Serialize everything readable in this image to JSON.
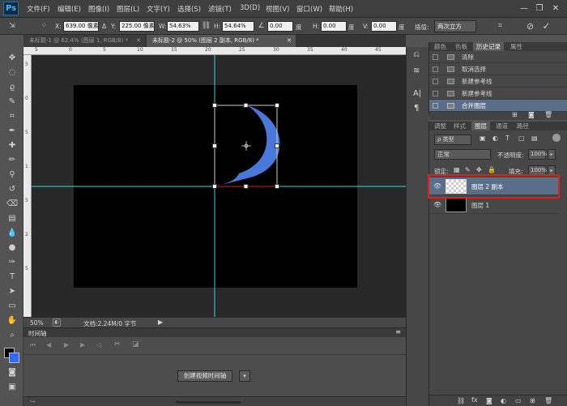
{
  "app": {
    "logo": "Ps"
  },
  "menu": [
    "文件(F)",
    "编辑(E)",
    "图像(I)",
    "图层(L)",
    "文字(Y)",
    "选择(S)",
    "滤镜(T)",
    "3D(D)",
    "视图(V)",
    "窗口(W)",
    "帮助(H)"
  ],
  "window_controls": {
    "minimize": "—",
    "restore": "❐",
    "close": "✕"
  },
  "options": {
    "x_label": "X:",
    "x_value": "639.00 像素",
    "y_label": "Y:",
    "y_value": "225.00 像素",
    "w_label": "W:",
    "w_value": "54.63%",
    "h_label": "H:",
    "h_value": "54.64%",
    "angle_value": "0.00",
    "angle_unit": "度",
    "hskew_label": "H:",
    "hskew_value": "0.00",
    "hskew_unit": "度",
    "vskew_label": "V:",
    "vskew_value": "0.00",
    "vskew_unit": "度",
    "interp_label": "插值:",
    "interp_value": "两次立方"
  },
  "tabs": [
    {
      "label": "未标题-1 @ 62.4% (图层 1, RGB/8) *",
      "active": false
    },
    {
      "label": "未标题-2 @ 50% (图层 2 副本, RGB/8) *",
      "active": true
    }
  ],
  "ruler": {
    "top": [
      "5",
      "0",
      "5",
      "10",
      "15",
      "20",
      "25",
      "30",
      "35",
      "40",
      "45"
    ],
    "left": [
      "5",
      "0",
      "5",
      "1",
      "5",
      "2",
      "5"
    ]
  },
  "status": {
    "zoom": "50%",
    "doc": "文档:2.24M/0 字节"
  },
  "timeline": {
    "title": "时间轴",
    "create_button": "创建视频时间轴"
  },
  "history": {
    "tabs": [
      "颜色",
      "色板",
      "历史记录",
      "属性"
    ],
    "active_tab": 2,
    "items": [
      "清除",
      "取消选择",
      "新建参考线",
      "新建参考线",
      "合并图层"
    ],
    "selected": 4
  },
  "layers": {
    "tabs": [
      "调整",
      "样式",
      "图层",
      "通道",
      "路径"
    ],
    "active_tab": 2,
    "filter_label": "ρ 类型",
    "blend_mode": "正常",
    "opacity_label": "不透明度:",
    "opacity_value": "100%",
    "lock_label": "锁定:",
    "fill_label": "填充:",
    "fill_value": "100%",
    "items": [
      {
        "name": "图层 2 副本",
        "selected": true
      },
      {
        "name": "图层 1",
        "selected": false
      }
    ]
  },
  "colors": {
    "accent_blue": "#4a78d8",
    "guide": "#3ad6dc",
    "highlight_box": "#e02020",
    "selected_row": "#5a6e8a"
  }
}
